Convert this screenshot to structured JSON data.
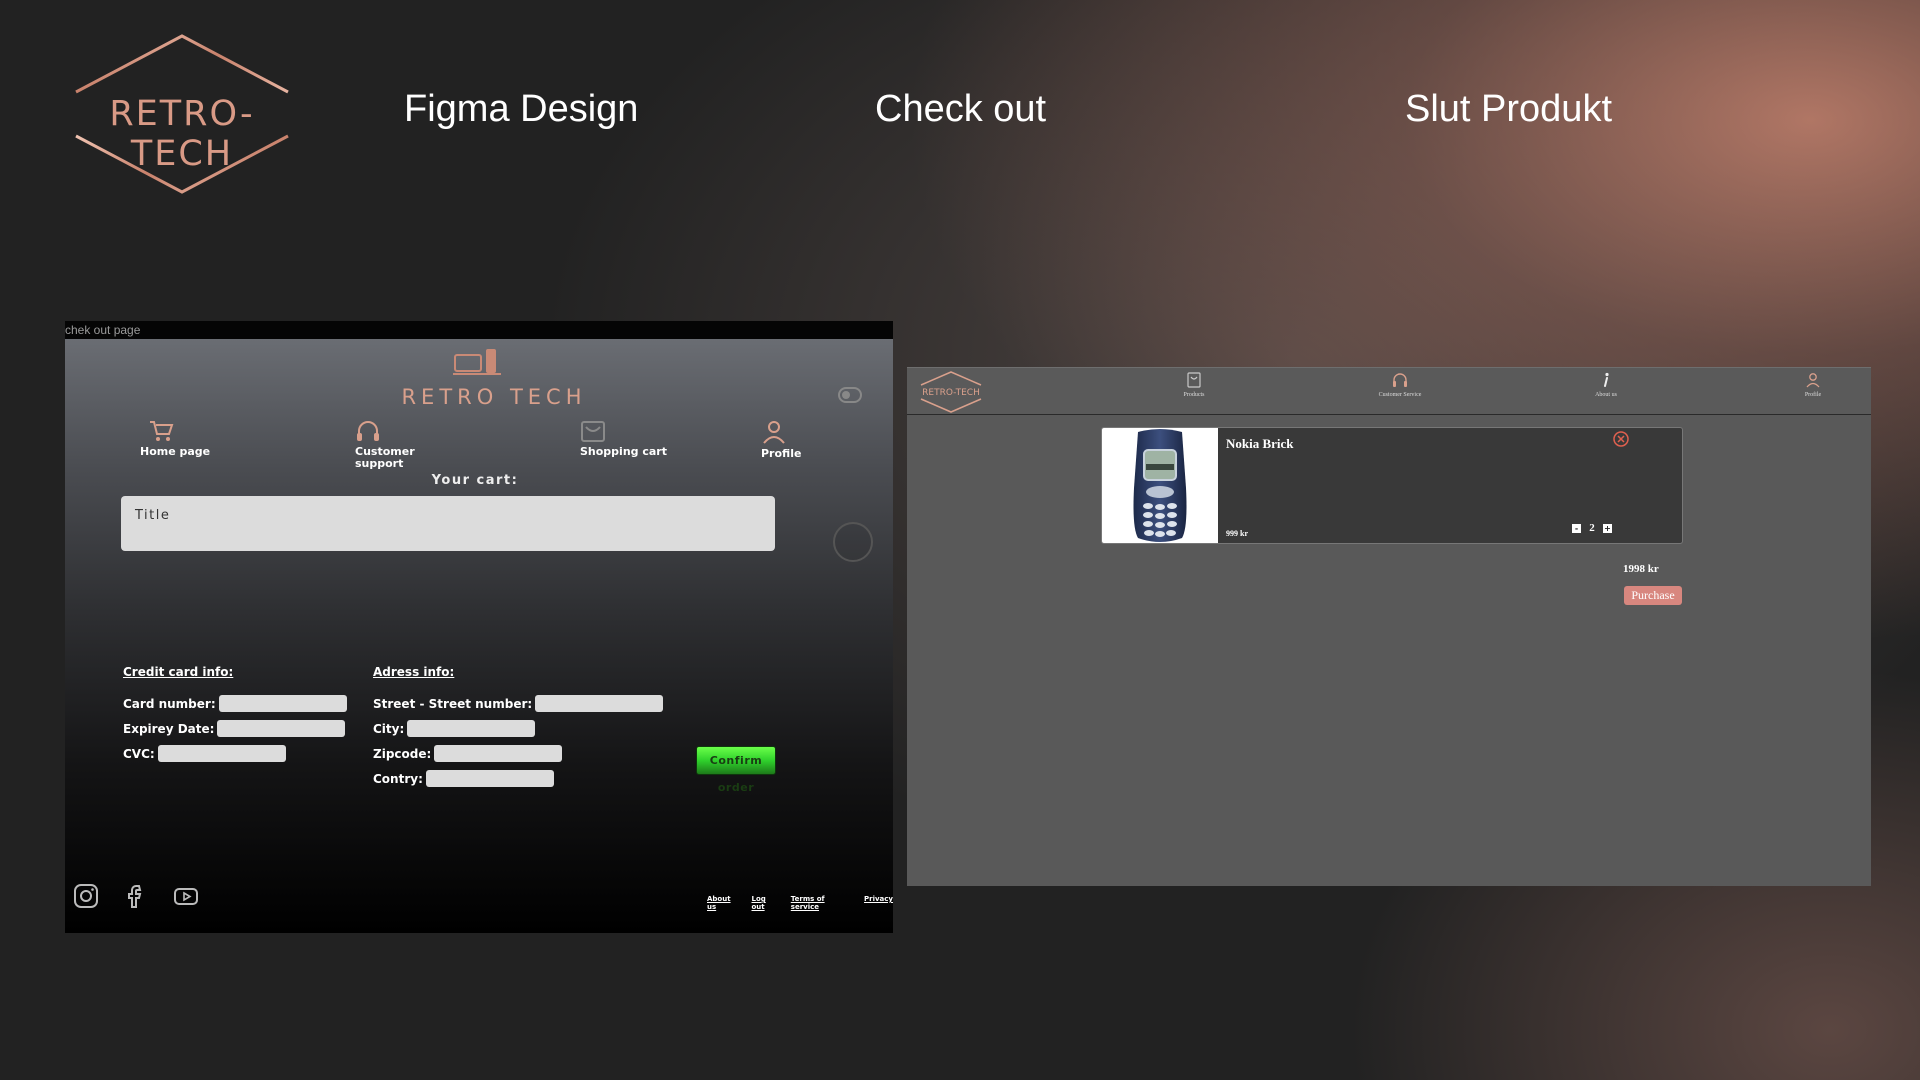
{
  "header": {
    "brand": "RETRO-TECH",
    "figma_heading": "Figma Design",
    "checkout_heading": "Check out",
    "final_heading": "Slut Produkt"
  },
  "figma_panel": {
    "frame_label": "chek out page",
    "logo_text": "RETRO TECH",
    "nav": [
      {
        "label": "Home page",
        "icon": "cart-icon"
      },
      {
        "label": "Customer support",
        "icon": "headphones-icon"
      },
      {
        "label": "Shopping cart",
        "icon": "shopping-bag-icon"
      },
      {
        "label": "Profile",
        "icon": "user-icon"
      }
    ],
    "cart_heading": "Your cart:",
    "title_box": "Title",
    "credit_card": {
      "heading": "Credit card info:",
      "fields": [
        "Card number:",
        "Expirey Date:",
        "CVC:"
      ]
    },
    "address": {
      "heading": "Adress info:",
      "fields": [
        "Street - Street number:",
        "City:",
        "Zipcode:",
        "Contry:"
      ]
    },
    "confirm_button": "Confirm order",
    "footer_links": [
      "About us",
      "Log out",
      "Terms of service",
      "Privacy"
    ],
    "social_icons": [
      "instagram-icon",
      "facebook-icon",
      "youtube-icon"
    ],
    "colors": {
      "accent": "#d9a08c",
      "confirm": "#3ad636"
    }
  },
  "final_panel": {
    "logo_text": "RETRO-TECH",
    "nav": [
      {
        "label": "Products",
        "icon": "bag-icon"
      },
      {
        "label": "Customer Service",
        "icon": "headphones-icon"
      },
      {
        "label": "About us",
        "icon": "info-icon"
      },
      {
        "label": "Profile",
        "icon": "user-icon"
      }
    ],
    "cart_item": {
      "name": "Nokia Brick",
      "price": "999 kr",
      "quantity": "2",
      "decrement": "-",
      "increment": "+"
    },
    "total": "1998 kr",
    "purchase_button": "Purchase",
    "colors": {
      "purchase": "#d8877f",
      "remove": "#e0604f"
    }
  }
}
